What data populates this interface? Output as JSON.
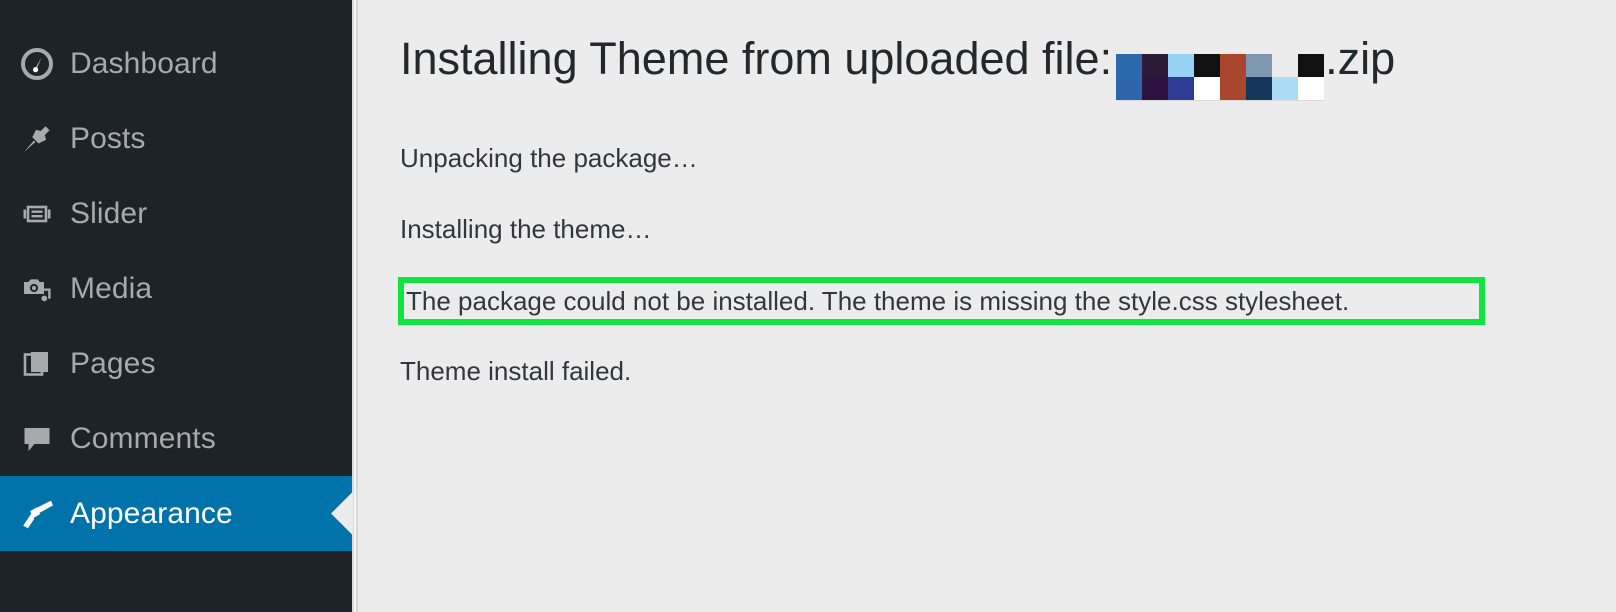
{
  "sidebar": {
    "items": [
      {
        "label": "Dashboard",
        "icon": "dashboard-gauge-icon",
        "name": "dashboard",
        "current": false
      },
      {
        "label": "Posts",
        "icon": "pin-icon",
        "name": "posts",
        "current": false
      },
      {
        "label": "Slider",
        "icon": "slides-icon",
        "name": "slider",
        "current": false
      },
      {
        "label": "Media",
        "icon": "camera-media-icon",
        "name": "media",
        "current": false
      },
      {
        "label": "Pages",
        "icon": "pages-icon",
        "name": "pages",
        "current": false
      },
      {
        "label": "Comments",
        "icon": "comment-bubble-icon",
        "name": "comments",
        "current": false
      },
      {
        "label": "Appearance",
        "icon": "paintbrush-icon",
        "name": "appearance",
        "current": true
      }
    ],
    "colors": {
      "background": "#1d2327",
      "text": "#a7aaad",
      "current_background": "#0073aa",
      "current_text": "#ffffff"
    }
  },
  "main": {
    "title_prefix": "Installing Theme from uploaded file:",
    "title_suffix": ".zip",
    "redacted_filename": {
      "description": "pixelated-redaction",
      "columns": 8,
      "rows": 2,
      "cells": [
        "#2b69ab",
        "#2e66ab",
        "#2d1c38",
        "#2e1340",
        "#96d2f3",
        "#2e3c96",
        "#111111",
        "#ffffff",
        "#a8472e",
        "#a8472e",
        "#8097b0",
        "#16375c",
        "#ececed",
        "#aadcf5",
        "#111111",
        "#ffffff"
      ]
    },
    "log": [
      {
        "name": "unpacking",
        "text": "Unpacking the package…"
      },
      {
        "name": "installing",
        "text": "Installing the theme…"
      },
      {
        "name": "failed",
        "text": "Theme install failed."
      }
    ],
    "error": {
      "text": "The package could not be installed. The theme is missing the style.css stylesheet.",
      "highlight_color": "#0fe53e"
    },
    "colors": {
      "background": "#ececed",
      "title_text": "#23282d",
      "body_text": "#32373c"
    }
  }
}
